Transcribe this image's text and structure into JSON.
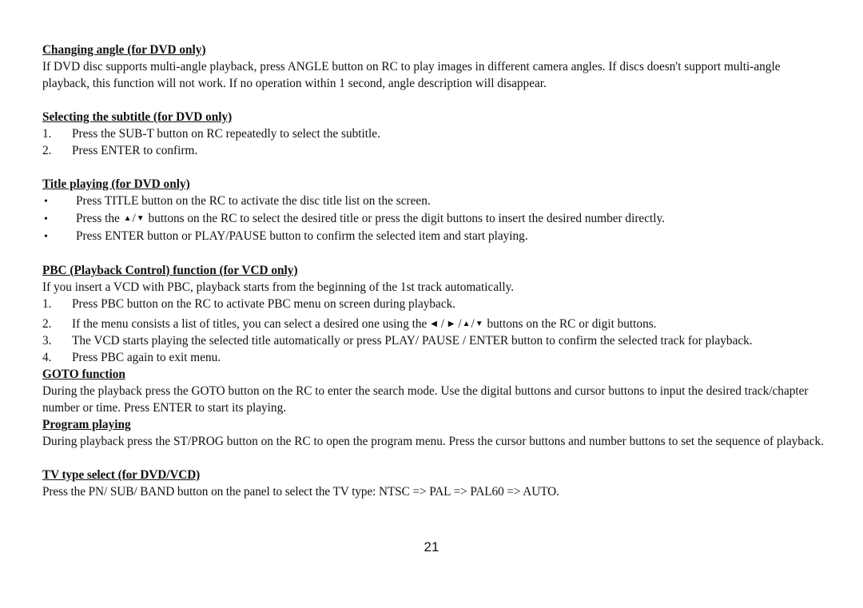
{
  "sections": {
    "angle": {
      "heading": "Changing angle (for DVD only)",
      "body": "If DVD disc supports multi-angle playback, press ANGLE button on RC to play images in different camera angles. If discs doesn't support multi-angle playback, this function will not work. If no operation within 1 second, angle description will disappear."
    },
    "subtitle": {
      "heading": "Selecting the subtitle (for DVD only)",
      "items": [
        {
          "num": "1.",
          "text": "Press the SUB-T button on RC repeatedly to select the subtitle."
        },
        {
          "num": "2.",
          "text": "Press ENTER to confirm."
        }
      ]
    },
    "title": {
      "heading": "Title playing (for DVD only)",
      "bullet": "•",
      "item1": "Press TITLE button on the RC to activate the disc title list on the screen.",
      "item2_pre": "Press the",
      "item2_post": "buttons on the RC to select the desired title or press the digit buttons to insert the desired number directly.",
      "item3": "Press ENTER button or PLAY/PAUSE button to confirm the selected item and start playing."
    },
    "pbc": {
      "heading": "PBC (Playback Control) function (for VCD only)",
      "intro": "If you insert a VCD with PBC, playback starts from the beginning of the 1st track automatically.",
      "item1_num": "1.",
      "item1": "Press PBC button on the RC to activate PBC menu on screen during playback.",
      "item2_num": "2.",
      "item2_pre": "If the menu consists a list of titles, you can select a desired one using the",
      "item2_post": "buttons on the RC or digit buttons.",
      "item3_num": "3.",
      "item3": "The VCD starts playing the selected title automatically or press PLAY/ PAUSE / ENTER button to confirm the selected track for playback.",
      "item4_num": "4.",
      "item4": "Press PBC again to exit menu."
    },
    "goto": {
      "heading": "GOTO function",
      "body": "During the playback press the GOTO button on the RC to enter the search mode. Use the digital buttons and cursor buttons to input the desired track/chapter number or time. Press ENTER to start its playing."
    },
    "program": {
      "heading": "Program playing",
      "body": "During playback press the ST/PROG button on the RC to open the program menu. Press the cursor buttons and number buttons to set the sequence of playback."
    },
    "tv": {
      "heading": "TV type select (for DVD/VCD)",
      "body": "Press the PN/ SUB/ BAND button on the panel to select the TV type: NTSC => PAL => PAL60 => AUTO."
    }
  },
  "symbols": {
    "up": "▲",
    "down": "▼",
    "left": "◀",
    "right": "▶",
    "slash": "/"
  },
  "page_number": "21"
}
